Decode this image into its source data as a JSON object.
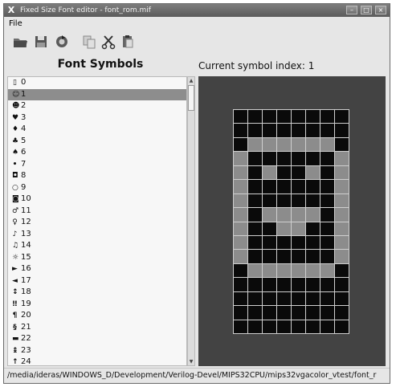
{
  "window": {
    "title": "Fixed Size Font editor - font_rom.mif",
    "app_icon": "X",
    "buttons": {
      "minimize": "–",
      "maximize": "□",
      "close": "×"
    }
  },
  "menu": {
    "file": "File"
  },
  "toolbar": {
    "icons": [
      "open-folder-icon",
      "save-disk-icon",
      "reload-icon",
      "copy-icon",
      "cut-scissors-icon",
      "paste-icon"
    ]
  },
  "left_panel": {
    "title": "Font Symbols",
    "items": [
      {
        "glyph": "▯",
        "label": "0"
      },
      {
        "glyph": "☺",
        "label": "1"
      },
      {
        "glyph": "☻",
        "label": "2"
      },
      {
        "glyph": "♥",
        "label": "3"
      },
      {
        "glyph": "♦",
        "label": "4"
      },
      {
        "glyph": "♣",
        "label": "5"
      },
      {
        "glyph": "♠",
        "label": "6"
      },
      {
        "glyph": "•",
        "label": "7"
      },
      {
        "glyph": "◘",
        "label": "8"
      },
      {
        "glyph": "○",
        "label": "9"
      },
      {
        "glyph": "◙",
        "label": "10"
      },
      {
        "glyph": "♂",
        "label": "11"
      },
      {
        "glyph": "♀",
        "label": "12"
      },
      {
        "glyph": "♪",
        "label": "13"
      },
      {
        "glyph": "♫",
        "label": "14"
      },
      {
        "glyph": "☼",
        "label": "15"
      },
      {
        "glyph": "►",
        "label": "16"
      },
      {
        "glyph": "◄",
        "label": "17"
      },
      {
        "glyph": "↕",
        "label": "18"
      },
      {
        "glyph": "‼",
        "label": "19"
      },
      {
        "glyph": "¶",
        "label": "20"
      },
      {
        "glyph": "§",
        "label": "21"
      },
      {
        "glyph": "▬",
        "label": "22"
      },
      {
        "glyph": "↨",
        "label": "23"
      },
      {
        "glyph": "↑",
        "label": "24"
      }
    ],
    "selected_index": 1
  },
  "right_panel": {
    "index_label": "Current symbol index: 1",
    "bitmap": [
      "00000000",
      "00000000",
      "01111110",
      "10000001",
      "10100101",
      "10000001",
      "10000001",
      "10111101",
      "10011001",
      "10000001",
      "10000001",
      "01111110",
      "00000000",
      "00000000",
      "00000000",
      "00000000"
    ]
  },
  "status": {
    "path": "/media/ideras/WINDOWS_D/Development/Verilog-Devel/MIPS32CPU/mips32vgacolor_vtest/font_r"
  },
  "colors": {
    "pixel_on": "#8c8c8c",
    "pixel_off": "#0a0a0a",
    "canvas_bg": "#434343",
    "selection": "#8d8d8d"
  }
}
